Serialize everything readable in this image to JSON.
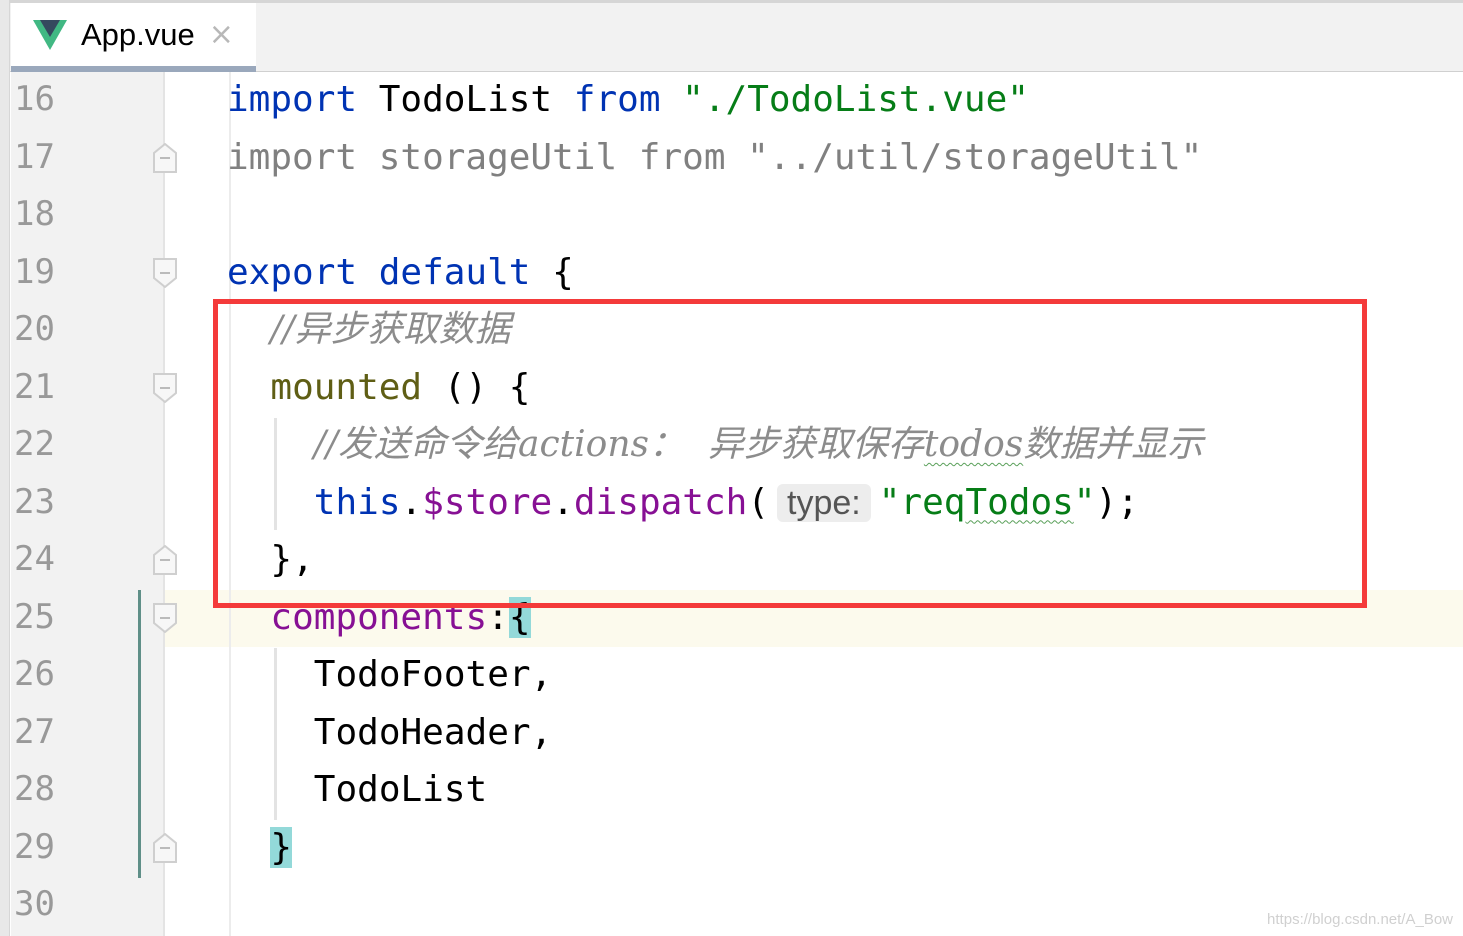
{
  "tab": {
    "title": "App.vue",
    "icon": "vue-logo-icon",
    "close": "×"
  },
  "colors": {
    "keyword": "#0033b3",
    "string": "#067d17",
    "comment": "#8c8c8c",
    "property": "#871094",
    "highlight_box": "#f43a3a",
    "brace_match": "#93d9d9"
  },
  "lines": [
    {
      "n": "16",
      "indent": 0,
      "tokens": [
        {
          "t": "import ",
          "c": "kw"
        },
        {
          "t": "TodoList ",
          "c": ""
        },
        {
          "t": "from ",
          "c": "kw"
        },
        {
          "t": "\"./TodoList.vue\"",
          "c": "str"
        }
      ]
    },
    {
      "n": "17",
      "indent": 0,
      "tokens": [
        {
          "t": "import storageUtil from \"../util/storageUtil\"",
          "c": "gray"
        }
      ]
    },
    {
      "n": "18",
      "indent": 0,
      "tokens": []
    },
    {
      "n": "19",
      "indent": 0,
      "tokens": [
        {
          "t": "export default ",
          "c": "kw"
        },
        {
          "t": "{",
          "c": ""
        }
      ]
    },
    {
      "n": "20",
      "indent": 2,
      "tokens": [
        {
          "t": "//异步获取数据",
          "c": "cm"
        }
      ]
    },
    {
      "n": "21",
      "indent": 2,
      "tokens": [
        {
          "t": "mounted",
          "c": "fn"
        },
        {
          "t": " () {",
          "c": ""
        }
      ]
    },
    {
      "n": "22",
      "indent": 4,
      "tokens": [
        {
          "t": "//发送命令给actions：  异步获取保存",
          "c": "cm"
        },
        {
          "t": "todos",
          "c": "cm squig"
        },
        {
          "t": "数据并显示",
          "c": "cm"
        }
      ]
    },
    {
      "n": "23",
      "indent": 4,
      "tokens": [
        {
          "t": "this",
          "c": "kw"
        },
        {
          "t": ".",
          "c": ""
        },
        {
          "t": "$store",
          "c": "prop"
        },
        {
          "t": ".",
          "c": ""
        },
        {
          "t": "dispatch",
          "c": "prop"
        },
        {
          "t": "(",
          "c": ""
        },
        {
          "t": "type:",
          "c": "hint"
        },
        {
          "t": "\"req",
          "c": "str"
        },
        {
          "t": "Todos",
          "c": "str squig"
        },
        {
          "t": "\"",
          "c": "str"
        },
        {
          "t": ");",
          "c": ""
        }
      ]
    },
    {
      "n": "24",
      "indent": 2,
      "tokens": [
        {
          "t": "},",
          "c": ""
        }
      ]
    },
    {
      "n": "25",
      "indent": 2,
      "tokens": [
        {
          "t": "components",
          "c": "prop"
        },
        {
          "t": ":",
          "c": ""
        },
        {
          "t": "{",
          "c": "brace"
        }
      ]
    },
    {
      "n": "26",
      "indent": 4,
      "tokens": [
        {
          "t": "TodoFooter,",
          "c": ""
        }
      ]
    },
    {
      "n": "27",
      "indent": 4,
      "tokens": [
        {
          "t": "TodoHeader,",
          "c": ""
        }
      ]
    },
    {
      "n": "28",
      "indent": 4,
      "tokens": [
        {
          "t": "TodoList",
          "c": ""
        }
      ]
    },
    {
      "n": "29",
      "indent": 2,
      "tokens": [
        {
          "t": "}",
          "c": "brace"
        }
      ]
    },
    {
      "n": "30",
      "indent": 0,
      "tokens": []
    }
  ],
  "watermark": "https://blog.csdn.net/A_Bow"
}
